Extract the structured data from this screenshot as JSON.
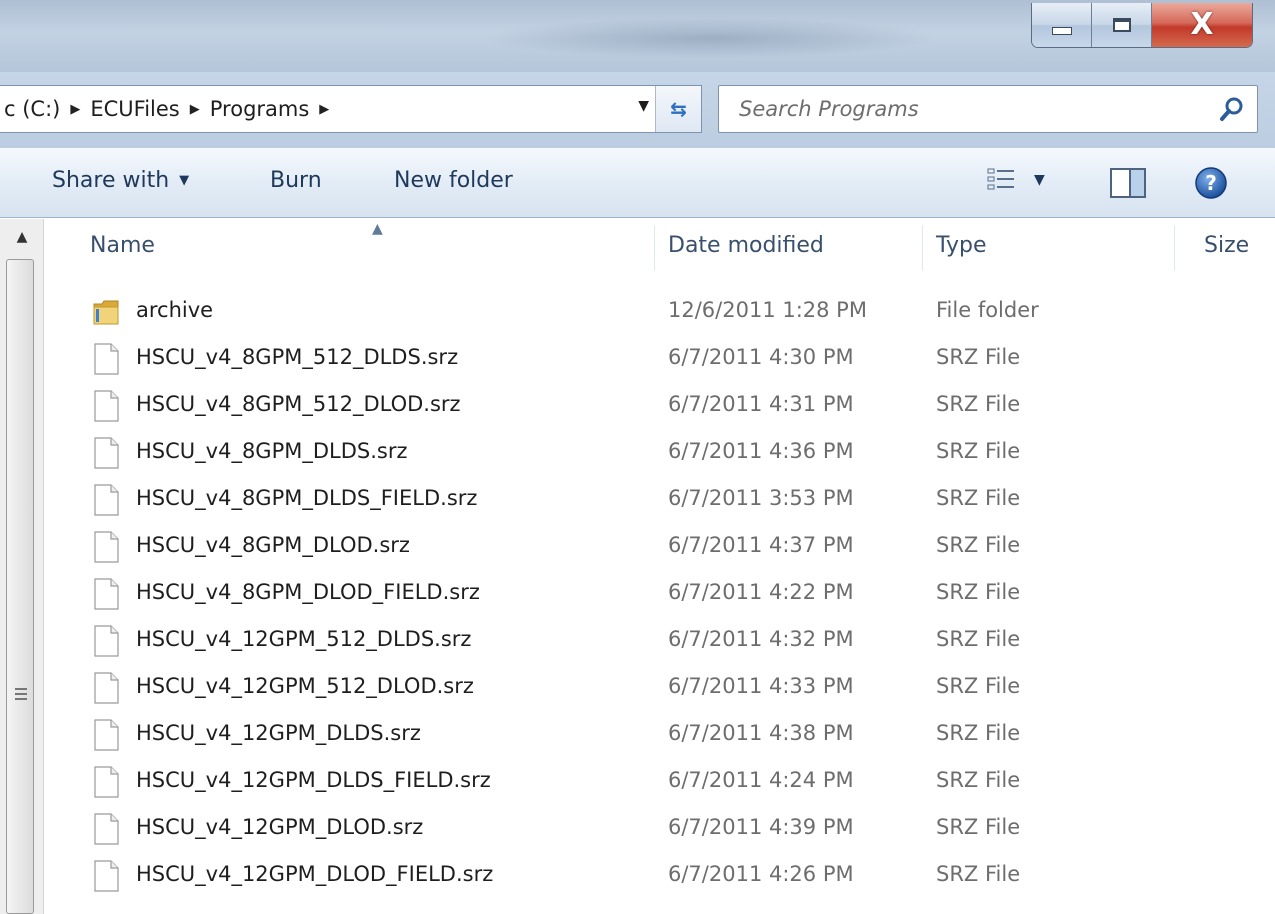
{
  "window": {
    "minimize_icon": "minimize-icon",
    "maximize_icon": "maximize-icon",
    "close_label": "X"
  },
  "address": {
    "crumbs": [
      "c (C:)",
      "ECUFiles",
      "Programs"
    ],
    "search_placeholder": "Search Programs"
  },
  "toolbar": {
    "share_label": "Share with",
    "burn_label": "Burn",
    "new_folder_label": "New folder"
  },
  "columns": {
    "name": "Name",
    "date": "Date modified",
    "type": "Type",
    "size": "Size"
  },
  "files": [
    {
      "name": "archive",
      "date": "12/6/2011 1:28 PM",
      "type": "File folder",
      "kind": "folder"
    },
    {
      "name": "HSCU_v4_8GPM_512_DLDS.srz",
      "date": "6/7/2011 4:30 PM",
      "type": "SRZ File",
      "kind": "file"
    },
    {
      "name": "HSCU_v4_8GPM_512_DLOD.srz",
      "date": "6/7/2011 4:31 PM",
      "type": "SRZ File",
      "kind": "file"
    },
    {
      "name": "HSCU_v4_8GPM_DLDS.srz",
      "date": "6/7/2011 4:36 PM",
      "type": "SRZ File",
      "kind": "file"
    },
    {
      "name": "HSCU_v4_8GPM_DLDS_FIELD.srz",
      "date": "6/7/2011 3:53 PM",
      "type": "SRZ File",
      "kind": "file"
    },
    {
      "name": "HSCU_v4_8GPM_DLOD.srz",
      "date": "6/7/2011 4:37 PM",
      "type": "SRZ File",
      "kind": "file"
    },
    {
      "name": "HSCU_v4_8GPM_DLOD_FIELD.srz",
      "date": "6/7/2011 4:22 PM",
      "type": "SRZ File",
      "kind": "file"
    },
    {
      "name": "HSCU_v4_12GPM_512_DLDS.srz",
      "date": "6/7/2011 4:32 PM",
      "type": "SRZ File",
      "kind": "file"
    },
    {
      "name": "HSCU_v4_12GPM_512_DLOD.srz",
      "date": "6/7/2011 4:33 PM",
      "type": "SRZ File",
      "kind": "file"
    },
    {
      "name": "HSCU_v4_12GPM_DLDS.srz",
      "date": "6/7/2011 4:38 PM",
      "type": "SRZ File",
      "kind": "file"
    },
    {
      "name": "HSCU_v4_12GPM_DLDS_FIELD.srz",
      "date": "6/7/2011 4:24 PM",
      "type": "SRZ File",
      "kind": "file"
    },
    {
      "name": "HSCU_v4_12GPM_DLOD.srz",
      "date": "6/7/2011 4:39 PM",
      "type": "SRZ File",
      "kind": "file"
    },
    {
      "name": "HSCU_v4_12GPM_DLOD_FIELD.srz",
      "date": "6/7/2011 4:26 PM",
      "type": "SRZ File",
      "kind": "file"
    }
  ],
  "colors": {
    "folder": "#e8c25a",
    "accent": "#1e395b",
    "secondary_text": "#6d6d6d",
    "close": "#c2392a"
  }
}
